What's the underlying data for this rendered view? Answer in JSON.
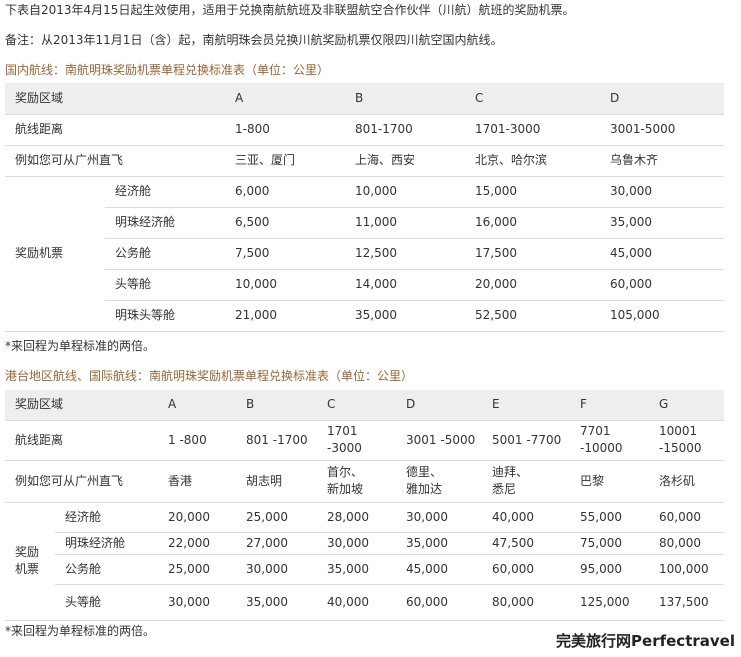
{
  "intro": {
    "line1": "下表自2013年4月15日起生效使用，适用于兑换南航航班及非联盟航空合作伙伴（川航）航班的奖励机票。",
    "line2": "备注：从2013年11月1日（含）起，南航明珠会员兑换川航奖励机票仅限四川航空国内航线。"
  },
  "domestic": {
    "title": "国内航线：南航明珠奖励机票单程兑换标准表（单位：公里）",
    "header": {
      "label": "奖励区域",
      "zones": [
        "A",
        "B",
        "C",
        "D"
      ]
    },
    "distance": {
      "label": "航线距离",
      "values": [
        "1-800",
        "801-1700",
        "1701-3000",
        "3001-5000"
      ]
    },
    "example": {
      "label": "例如您可从广州直飞",
      "values": [
        "三亚、厦门",
        "上海、西安",
        "北京、哈尔滨",
        "乌鲁木齐"
      ]
    },
    "group_label": "奖励机票",
    "classes": [
      {
        "name": "经济舱",
        "values": [
          "6,000",
          "10,000",
          "15,000",
          "30,000"
        ]
      },
      {
        "name": "明珠经济舱",
        "values": [
          "6,500",
          "11,000",
          "16,000",
          "35,000"
        ]
      },
      {
        "name": "公务舱",
        "values": [
          "7,500",
          "12,500",
          "17,500",
          "45,000"
        ]
      },
      {
        "name": "头等舱",
        "values": [
          "10,000",
          "14,000",
          "20,000",
          "60,000"
        ]
      },
      {
        "name": "明珠头等舱",
        "values": [
          "21,000",
          "35,000",
          "52,500",
          "105,000"
        ]
      }
    ],
    "note": "*来回程为单程标准的两倍。"
  },
  "international": {
    "title": "港台地区航线、国际航线：南航明珠奖励机票单程兑换标准表（单位：公里）",
    "header": {
      "label": "奖励区域",
      "zones": [
        "A",
        "B",
        "C",
        "D",
        "E",
        "F",
        "G"
      ]
    },
    "distance": {
      "label": "航线距离",
      "values": [
        [
          "1 -800"
        ],
        [
          "801 -1700"
        ],
        [
          "1701",
          "-3000"
        ],
        [
          "3001 -5000"
        ],
        [
          "5001 -7700"
        ],
        [
          "7701",
          "-10000"
        ],
        [
          "10001",
          "-15000"
        ]
      ]
    },
    "example": {
      "label": "例如您可从广州直飞",
      "values": [
        [
          "香港"
        ],
        [
          "胡志明"
        ],
        [
          "首尔、",
          "新加坡"
        ],
        [
          "德里、",
          "雅加达"
        ],
        [
          "迪拜、",
          "悉尼"
        ],
        [
          "巴黎"
        ],
        [
          "洛杉矶"
        ]
      ]
    },
    "group_label": [
      "奖励",
      "机票"
    ],
    "classes": [
      {
        "name": "经济舱",
        "values": [
          "20,000",
          "25,000",
          "28,000",
          "30,000",
          "40,000",
          "55,000",
          "60,000"
        ]
      },
      {
        "name": "明珠经济舱",
        "values": [
          "22,000",
          "27,000",
          "30,000",
          "35,000",
          "47,500",
          "75,000",
          "80,000"
        ]
      },
      {
        "name": "公务舱",
        "values": [
          "25,000",
          "30,000",
          "35,000",
          "45,000",
          "60,000",
          "95,000",
          "100,000"
        ]
      },
      {
        "name": "头等舱",
        "values": [
          "30,000",
          "35,000",
          "40,000",
          "60,000",
          "80,000",
          "125,000",
          "137,500"
        ]
      }
    ],
    "note": "*来回程为单程标准的两倍。"
  },
  "watermark": "完美旅行网Perfectravel"
}
